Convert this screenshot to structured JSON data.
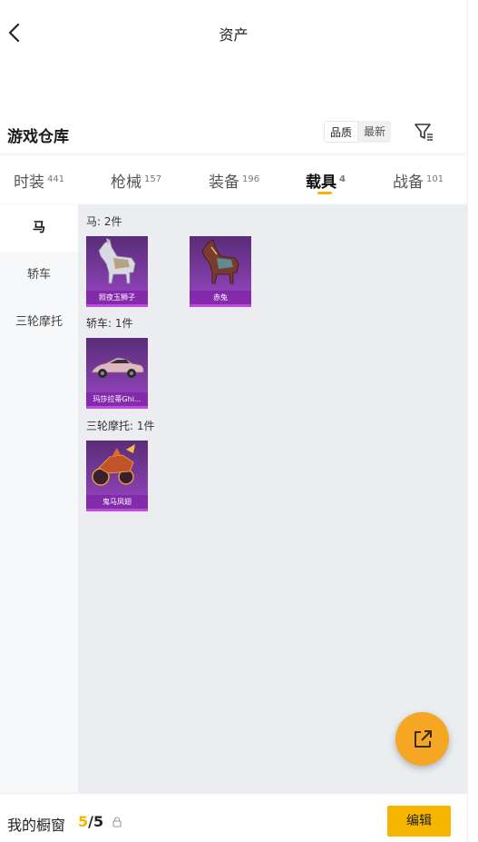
{
  "header": {
    "title": "资产",
    "back_icon": "chevron-left-icon"
  },
  "section": {
    "title": "游戏仓库",
    "sort_options": [
      "品质",
      "最新"
    ],
    "sort_selected": "品质",
    "filter_icon": "filter-icon"
  },
  "tabs": [
    {
      "label": "时装",
      "count": "441",
      "active": false
    },
    {
      "label": "枪械",
      "count": "157",
      "active": false
    },
    {
      "label": "装备",
      "count": "196",
      "active": false
    },
    {
      "label": "载具",
      "count": "4",
      "active": true
    },
    {
      "label": "战备",
      "count": "101",
      "active": false
    }
  ],
  "sidebar": {
    "items": [
      {
        "label": "马",
        "active": true
      },
      {
        "label": "轿车",
        "active": false
      },
      {
        "label": "三轮摩托",
        "active": false
      }
    ]
  },
  "groups": [
    {
      "label": "马: 2件",
      "items": [
        {
          "name": "照夜玉狮子"
        },
        {
          "name": "赤兔"
        }
      ]
    },
    {
      "label": "轿车: 1件",
      "items": [
        {
          "name": "玛莎拉蒂Ghi..."
        }
      ]
    },
    {
      "label": "三轮摩托: 1件",
      "items": [
        {
          "name": "鬼马凤翅"
        }
      ]
    }
  ],
  "fab": {
    "icon": "share-external-icon"
  },
  "bottom": {
    "label": "我的橱窗",
    "count_current": "5",
    "count_total": "/5",
    "lock_icon": "lock-icon",
    "edit_label": "编辑"
  },
  "colors": {
    "accent": "#f5b400",
    "rarity_purple": "#9c46c4",
    "fab": "#f5a623"
  }
}
